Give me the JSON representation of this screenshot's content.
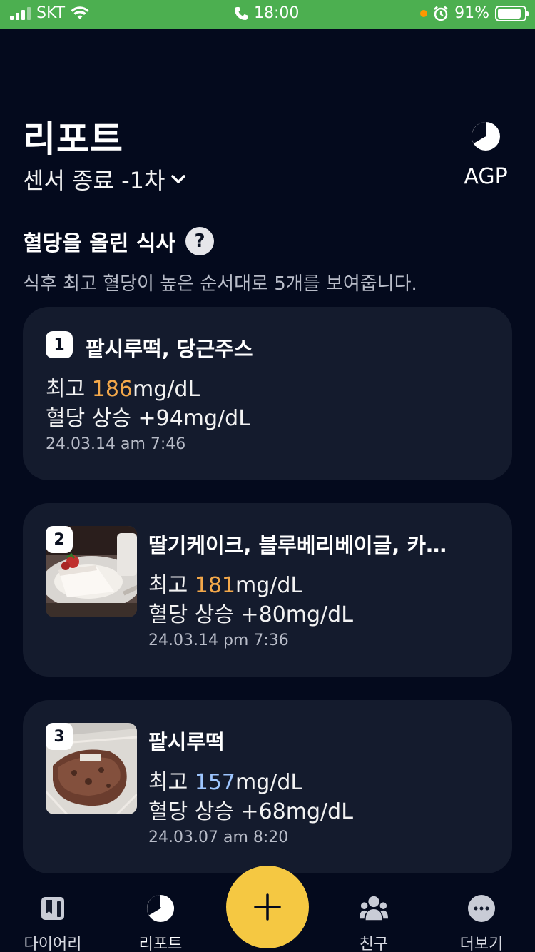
{
  "status_bar": {
    "carrier": "SKT",
    "time": "18:00",
    "battery": "91%"
  },
  "header": {
    "title": "리포트",
    "sensor_label": "센서 종료 -1차",
    "agp_label": "AGP"
  },
  "section": {
    "title": "혈당을 올린 식사",
    "help": "?",
    "description": "식후 최고 혈당이 높은 순서대로 5개를 보여줍니다."
  },
  "meals": [
    {
      "rank": "1",
      "name": "팥시루떡, 당근주스",
      "peak_prefix": "최고 ",
      "peak_value": "186",
      "peak_unit": "mg/dL",
      "rise": "혈당 상승 +94mg/dL",
      "datetime": "24.03.14 am 7:46",
      "peak_color": "#f3a84a"
    },
    {
      "rank": "2",
      "name": "딸기케이크, 블루베리베이글, 카…",
      "peak_prefix": "최고 ",
      "peak_value": "181",
      "peak_unit": "mg/dL",
      "rise": "혈당 상승 +80mg/dL",
      "datetime": "24.03.14 pm 7:36",
      "peak_color": "#f3a84a"
    },
    {
      "rank": "3",
      "name": "팥시루떡",
      "peak_prefix": "최고 ",
      "peak_value": "157",
      "peak_unit": "mg/dL",
      "rise": "혈당 상승 +68mg/dL",
      "datetime": "24.03.07 am 8:20",
      "peak_color": "#9ec6ff"
    }
  ],
  "nav": {
    "diary": "다이어리",
    "report": "리포트",
    "friends": "친구",
    "more": "더보기"
  },
  "colors": {
    "background": "#040a1d",
    "card": "#141b2d",
    "accent_fab": "#f5c842",
    "status_bar": "#4caf50"
  }
}
